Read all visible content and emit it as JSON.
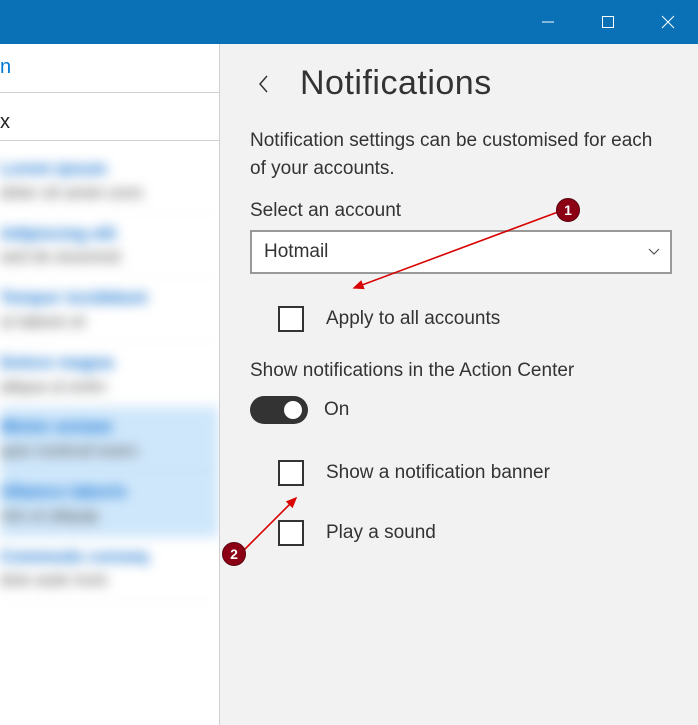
{
  "titlebar": {
    "minimize_tooltip": "Minimize",
    "maximize_tooltip": "Maximize",
    "close_tooltip": "Close"
  },
  "left": {
    "top_link_fragment": "n",
    "second_fragment": "x"
  },
  "settings": {
    "title": "Notifications",
    "description": "Notification settings can be customised for each of your accounts.",
    "select_label": "Select an account",
    "selected_account": "Hotmail",
    "apply_all_label": "Apply to all accounts",
    "action_center_label": "Show notifications in the Action Center",
    "toggle_state": "On",
    "banner_label": "Show a notification banner",
    "sound_label": "Play a sound"
  },
  "annotations": {
    "marker1": "1",
    "marker2": "2"
  }
}
